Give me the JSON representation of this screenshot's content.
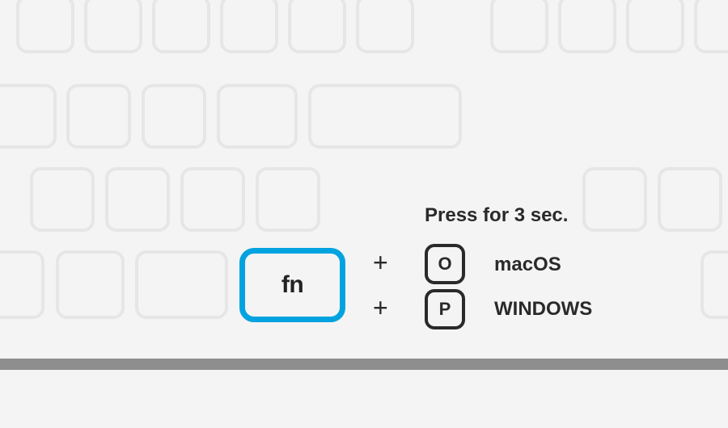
{
  "instruction": "Press for 3 sec.",
  "main_key": {
    "label": "fn",
    "highlight_color": "#00a3e0"
  },
  "combos": [
    {
      "plus": "+",
      "key": "O",
      "os": "macOS"
    },
    {
      "plus": "+",
      "key": "P",
      "os": "WINDOWS"
    }
  ]
}
